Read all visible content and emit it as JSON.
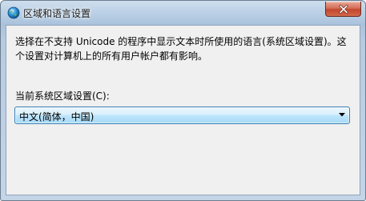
{
  "window": {
    "title": "区域和语言设置"
  },
  "titlebar": {
    "icons": {
      "app": "globe-icon",
      "close": "close-icon"
    }
  },
  "main": {
    "description": "选择在不支持 Unicode 的程序中显示文本时所使用的语言(系统区域设置)。这个设置对计算机上的所有用户帐户都有影响。",
    "locale_label": "当前系统区域设置(C):",
    "locale_select": {
      "selected": "中文(简体，中国)",
      "icon": "chevron-down-icon"
    }
  },
  "colors": {
    "close_button": "#c2472d",
    "combo_border": "#3c7fb1",
    "combo_fill": "#bee6fd",
    "panel_bg": "#f0f0f0"
  }
}
